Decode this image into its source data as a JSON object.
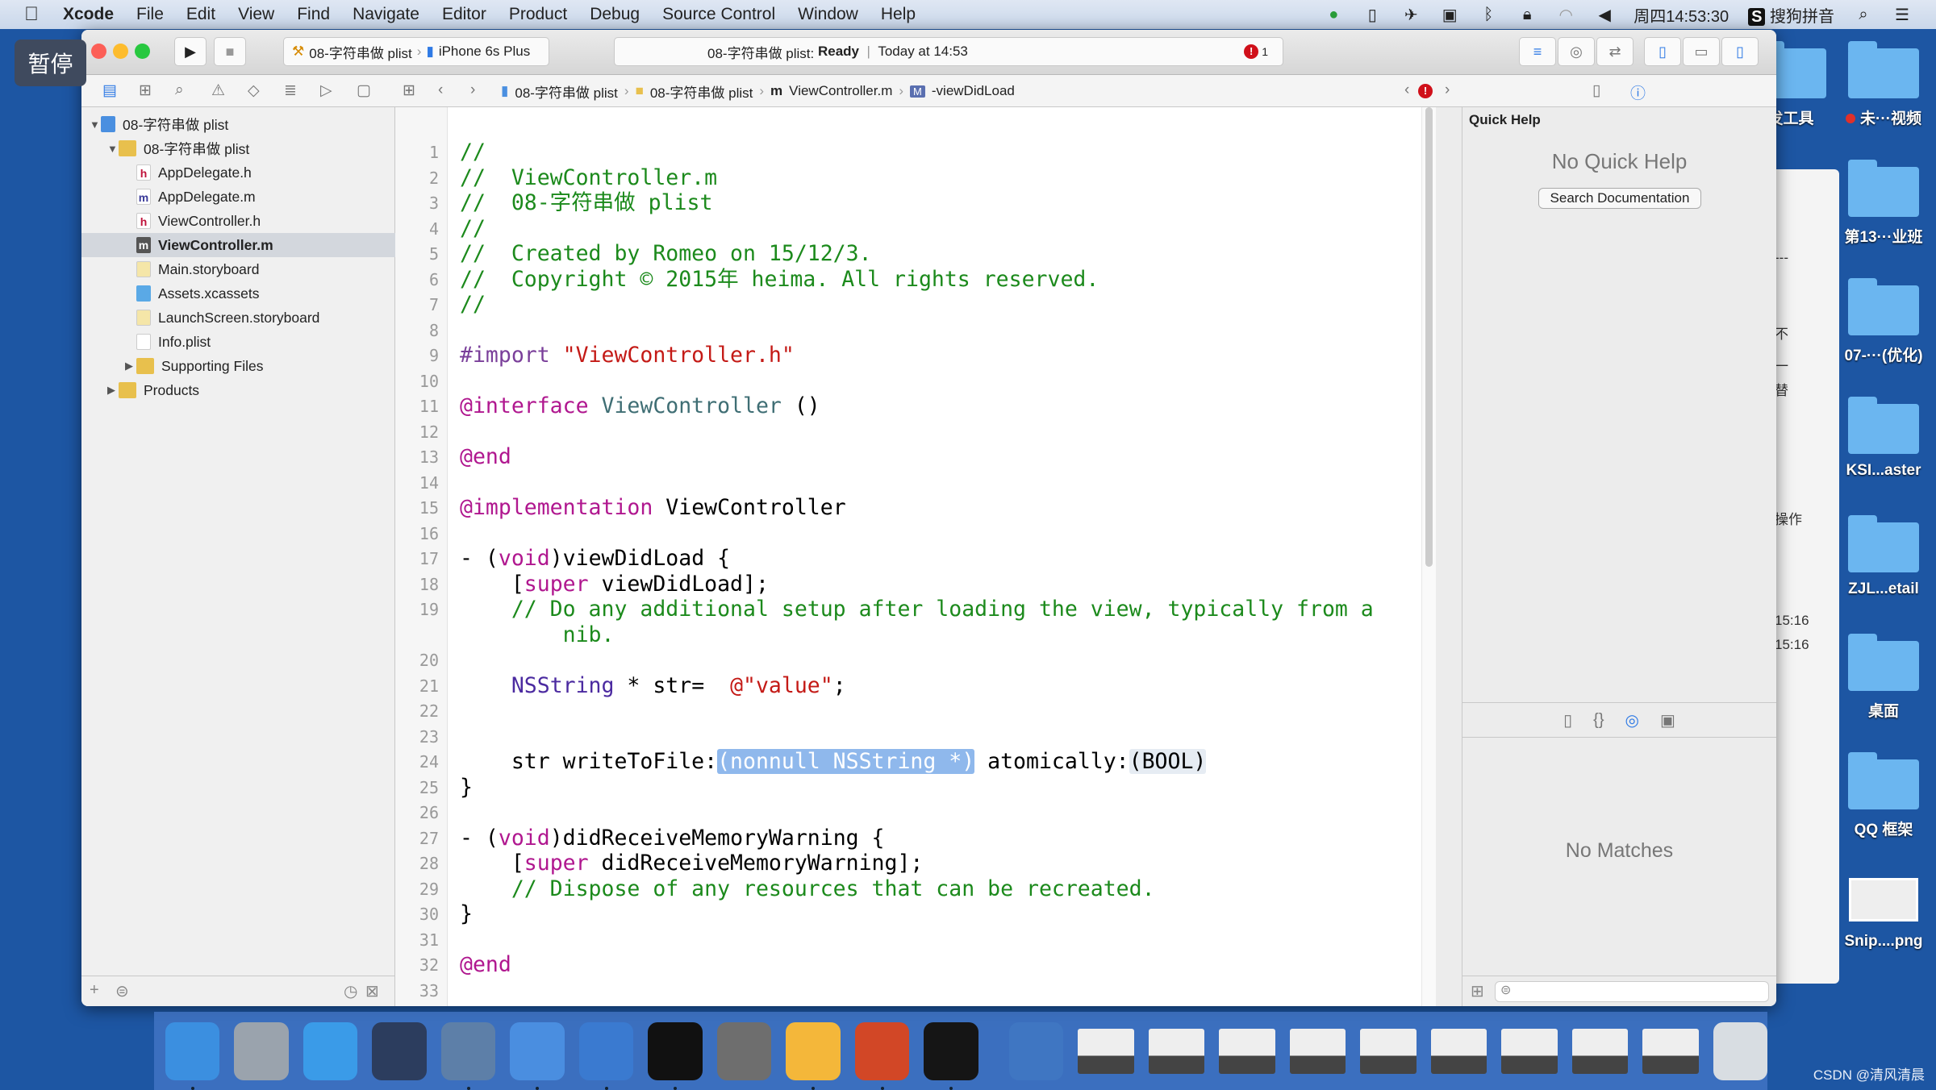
{
  "menubar": {
    "apple": "",
    "app": "Xcode",
    "items": [
      "File",
      "Edit",
      "View",
      "Find",
      "Navigate",
      "Editor",
      "Product",
      "Debug",
      "Source Control",
      "Window",
      "Help"
    ],
    "clock": "周四14:53:30",
    "ime": "搜狗拼音",
    "status_icons": [
      "cloud-sync-icon",
      "power-icon",
      "plane-icon",
      "camera-icon",
      "bluetooth-icon",
      "lock-icon",
      "wifi-icon",
      "volume-icon",
      "search-icon",
      "list-icon"
    ]
  },
  "overlay": {
    "pause": "暂停"
  },
  "toolbar": {
    "scheme": "08-字符串做 plist",
    "device": "iPhone 6s Plus",
    "activity_project": "08-字符串做 plist:",
    "activity_status": "Ready",
    "activity_sep": "|",
    "activity_time": "Today at 14:53",
    "error_count": "1"
  },
  "jumpbar": {
    "project": "08-字符串做 plist",
    "group": "08-字符串做 plist",
    "file": "ViewController.m",
    "method": "-viewDidLoad",
    "method_badge": "M"
  },
  "navigator": {
    "items": [
      {
        "label": "08-字符串做 plist",
        "icon": "proj",
        "depth": 0,
        "open": true
      },
      {
        "label": "08-字符串做 plist",
        "icon": "fold",
        "depth": 1,
        "open": true
      },
      {
        "label": "AppDelegate.h",
        "icon": "h",
        "depth": 2
      },
      {
        "label": "AppDelegate.m",
        "icon": "m",
        "depth": 2
      },
      {
        "label": "ViewController.h",
        "icon": "h",
        "depth": 2
      },
      {
        "label": "ViewController.m",
        "icon": "msel",
        "depth": 2,
        "selected": true
      },
      {
        "label": "Main.storyboard",
        "icon": "sb",
        "depth": 2
      },
      {
        "label": "Assets.xcassets",
        "icon": "as",
        "depth": 2
      },
      {
        "label": "LaunchScreen.storyboard",
        "icon": "sb",
        "depth": 2
      },
      {
        "label": "Info.plist",
        "icon": "pl",
        "depth": 2
      },
      {
        "label": "Supporting Files",
        "icon": "fold",
        "depth": 2,
        "closed": true
      },
      {
        "label": "Products",
        "icon": "fold",
        "depth": 1,
        "closed": true
      }
    ]
  },
  "code": [
    {
      "n": "1",
      "t": [
        [
          "//",
          "c"
        ]
      ]
    },
    {
      "n": "2",
      "t": [
        [
          "//  ViewController.m",
          "c"
        ]
      ]
    },
    {
      "n": "3",
      "t": [
        [
          "//  08-字符串做 plist",
          "c"
        ]
      ]
    },
    {
      "n": "4",
      "t": [
        [
          "//",
          "c"
        ]
      ]
    },
    {
      "n": "5",
      "t": [
        [
          "//  Created by Romeo on 15/12/3.",
          "c"
        ]
      ]
    },
    {
      "n": "6",
      "t": [
        [
          "//  Copyright © 2015年 heima. All rights reserved.",
          "c"
        ]
      ]
    },
    {
      "n": "7",
      "t": [
        [
          "//",
          "c"
        ]
      ]
    },
    {
      "n": "8",
      "t": []
    },
    {
      "n": "9",
      "t": [
        [
          "#import ",
          "p"
        ],
        [
          "\"ViewController.h\"",
          "s"
        ]
      ]
    },
    {
      "n": "10",
      "t": []
    },
    {
      "n": "11",
      "t": [
        [
          "@interface ",
          "k"
        ],
        [
          "ViewController",
          "t"
        ],
        [
          " ()",
          ""
        ]
      ]
    },
    {
      "n": "12",
      "t": []
    },
    {
      "n": "13",
      "t": [
        [
          "@end",
          "k"
        ]
      ]
    },
    {
      "n": "14",
      "t": []
    },
    {
      "n": "15",
      "t": [
        [
          "@implementation ",
          "k"
        ],
        [
          "ViewController",
          ""
        ]
      ]
    },
    {
      "n": "16",
      "t": []
    },
    {
      "n": "17",
      "t": [
        [
          "- (",
          ""
        ],
        [
          "void",
          "k"
        ],
        [
          ")viewDidLoad {",
          ""
        ]
      ]
    },
    {
      "n": "18",
      "t": [
        [
          "    [",
          ""
        ],
        [
          "super",
          "k"
        ],
        [
          " viewDidLoad];",
          ""
        ]
      ]
    },
    {
      "n": "19",
      "t": [
        [
          "    // Do any additional setup after loading the view, typically from a",
          "c"
        ]
      ]
    },
    {
      "n": "",
      "t": [
        [
          "        nib.",
          "c"
        ]
      ]
    },
    {
      "n": "20",
      "t": []
    },
    {
      "n": "21",
      "t": [
        [
          "    ",
          ""
        ],
        [
          "NSString",
          "n"
        ],
        [
          " * str=  ",
          ""
        ],
        [
          "@\"value\"",
          "s"
        ],
        [
          ";",
          ""
        ]
      ]
    },
    {
      "n": "22",
      "t": []
    },
    {
      "n": "23",
      "t": []
    },
    {
      "n": "24",
      "t": [
        [
          "    str writeToFile:",
          ""
        ],
        [
          "(nonnull NSString *)",
          "ph"
        ],
        [
          " atomically:",
          ""
        ],
        [
          "(BOOL)",
          "ph2"
        ]
      ]
    },
    {
      "n": "25",
      "t": [
        [
          "}",
          ""
        ]
      ]
    },
    {
      "n": "26",
      "t": []
    },
    {
      "n": "27",
      "t": [
        [
          "- (",
          ""
        ],
        [
          "void",
          "k"
        ],
        [
          ")didReceiveMemoryWarning {",
          ""
        ]
      ]
    },
    {
      "n": "28",
      "t": [
        [
          "    [",
          ""
        ],
        [
          "super",
          "k"
        ],
        [
          " didReceiveMemoryWarning];",
          ""
        ]
      ]
    },
    {
      "n": "29",
      "t": [
        [
          "    // Dispose of any resources that can be recreated.",
          "c"
        ]
      ]
    },
    {
      "n": "30",
      "t": [
        [
          "}",
          ""
        ]
      ]
    },
    {
      "n": "31",
      "t": []
    },
    {
      "n": "32",
      "t": [
        [
          "@end",
          "k"
        ]
      ]
    },
    {
      "n": "33",
      "t": []
    }
  ],
  "inspector": {
    "title": "Quick Help",
    "empty": "No Quick Help",
    "search_button": "Search Documentation",
    "library_empty": "No Matches"
  },
  "background_window": {
    "fragments": [
      "---",
      "不",
      "一",
      "替",
      "操作",
      "15:16",
      "15:16"
    ]
  },
  "desktop": {
    "icons": [
      {
        "label": "发工具",
        "type": "folder"
      },
      {
        "label": "未···视频",
        "type": "folder",
        "tag": "#e0302a"
      },
      {
        "label": "第13···业班",
        "type": "folder"
      },
      {
        "label": "07-···(优化)",
        "type": "folder"
      },
      {
        "label": "KSI...aster",
        "type": "folder"
      },
      {
        "label": "ZJL...etail",
        "type": "folder"
      },
      {
        "label": "桌面",
        "type": "folder"
      },
      {
        "label": "QQ 框架",
        "type": "folder"
      },
      {
        "label": "Snip....png",
        "type": "image"
      }
    ]
  },
  "dock": {
    "apps": [
      "finder",
      "launchpad",
      "safari",
      "mouse",
      "photo-slideshow",
      "xcode",
      "instruments",
      "terminal",
      "system-preferences",
      "sketch",
      "powerpoint",
      "console",
      "quicktime",
      "window-1",
      "window-2",
      "window-3",
      "window-4",
      "window-5",
      "window-6",
      "window-7",
      "window-8",
      "window-9",
      "trash"
    ]
  },
  "watermark": "CSDN @清风清晨",
  "colors": {
    "accent": "#2f7ae5",
    "error": "#d0101a",
    "comment": "#1c8a1c",
    "keyword": "#b0178f",
    "string": "#c41a16",
    "desktop": "#1d56a3"
  }
}
